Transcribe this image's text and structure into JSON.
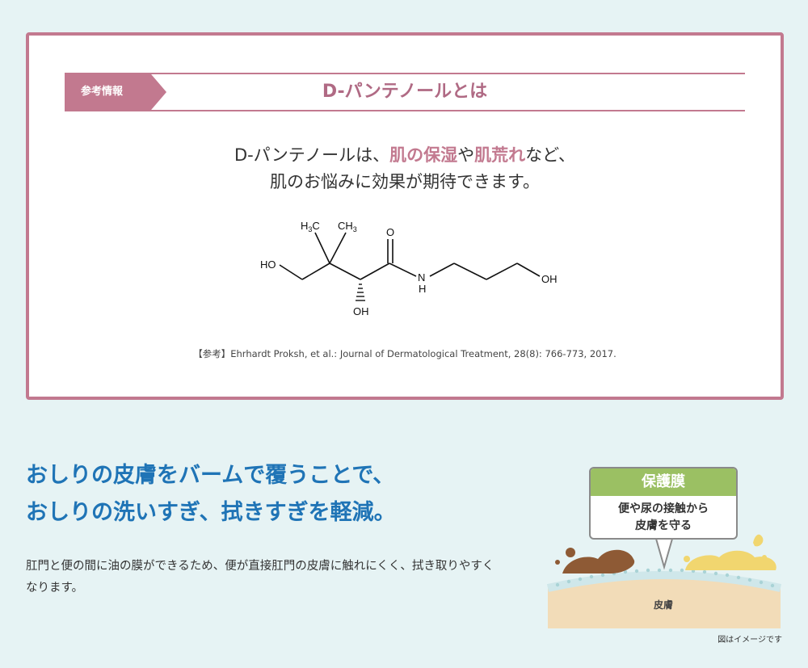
{
  "reference": {
    "tag": "参考情報",
    "title": "D-パンテノールとは",
    "lead_1_a": "D-パンテノールは、",
    "lead_1_hl1": "肌の保湿",
    "lead_1_b": "や",
    "lead_1_hl2": "肌荒れ",
    "lead_1_c": "など、",
    "lead_2": "肌のお悩みに効果が期待できます。",
    "molecule": {
      "h3c": "H",
      "h3c_sub": "3",
      "h3c_tail": "C",
      "ch3": "CH",
      "ch3_sub": "3",
      "o": "O",
      "ho": "HO",
      "n": "N",
      "h": "H",
      "oh_right": "OH",
      "oh_bottom": "OH"
    },
    "citation": "【参考】Ehrhardt Proksh, et al.: Journal of Dermatological Treatment, 28(8): 766-773, 2017."
  },
  "main": {
    "heading_1": "おしりの皮膚をバームで覆うことで、",
    "heading_2": "おしりの洗いすぎ、拭きすぎを軽減。",
    "body": "肛門と便の間に油の膜ができるため、便が直接肛門の皮膚に触れにくく、拭き取りやすくなります。"
  },
  "illustration": {
    "bubble_title": "保護膜",
    "bubble_line_1": "便や尿の接触から",
    "bubble_line_2": "皮膚を守る",
    "skin_label": "皮膚",
    "note": "図はイメージです"
  },
  "colors": {
    "accent_pink": "#c2798f",
    "heading_blue": "#1f74b6",
    "bubble_green": "#9bc063",
    "background": "#e6f3f4"
  }
}
